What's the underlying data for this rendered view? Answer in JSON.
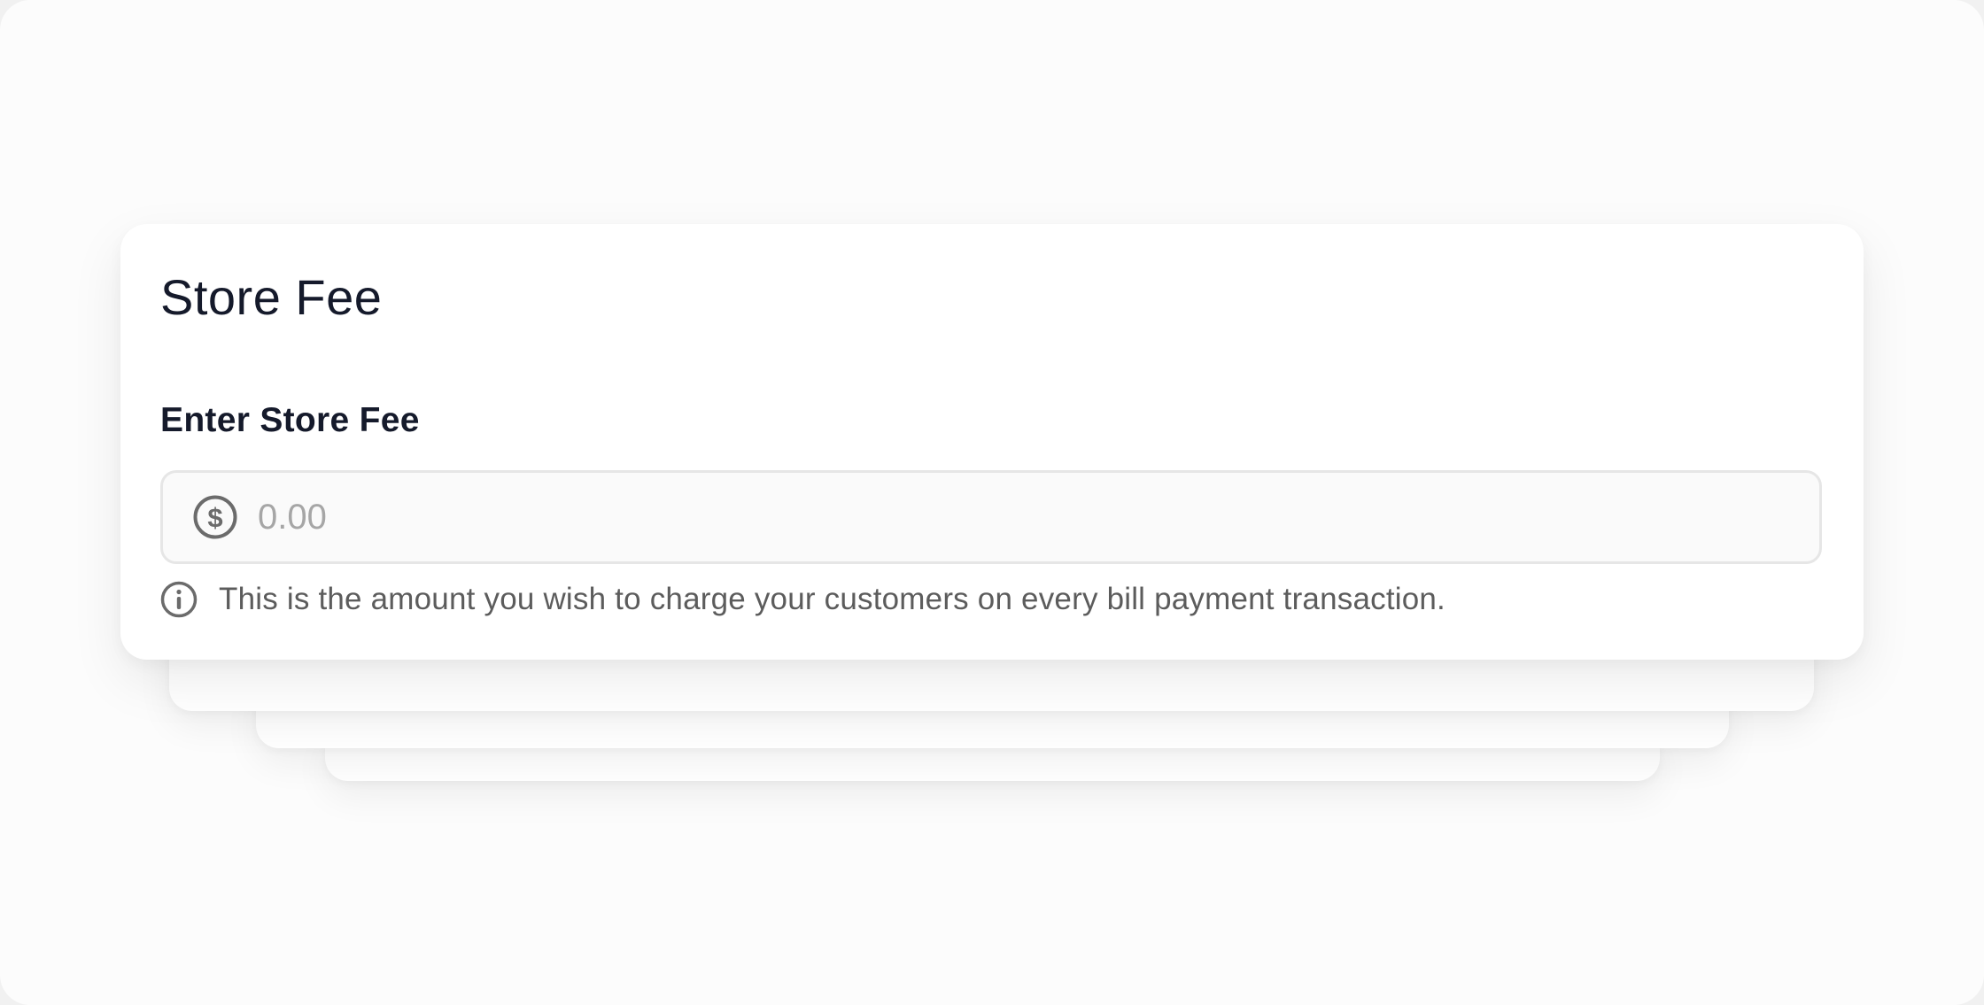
{
  "card": {
    "title": "Store Fee"
  },
  "fee_field": {
    "label": "Enter Store Fee",
    "placeholder": "0.00",
    "value": "",
    "icon": "dollar-circle-icon"
  },
  "helper": {
    "icon": "info-icon",
    "text": "This is the amount you wish to charge your customers on every bill payment transaction."
  },
  "colors": {
    "title": "#151a2b",
    "helper_text": "#5c5c5c",
    "placeholder": "#a6a6a6",
    "input_border": "#e6e6e6",
    "input_background": "#fafafa",
    "icon": "#6b6b6b"
  }
}
